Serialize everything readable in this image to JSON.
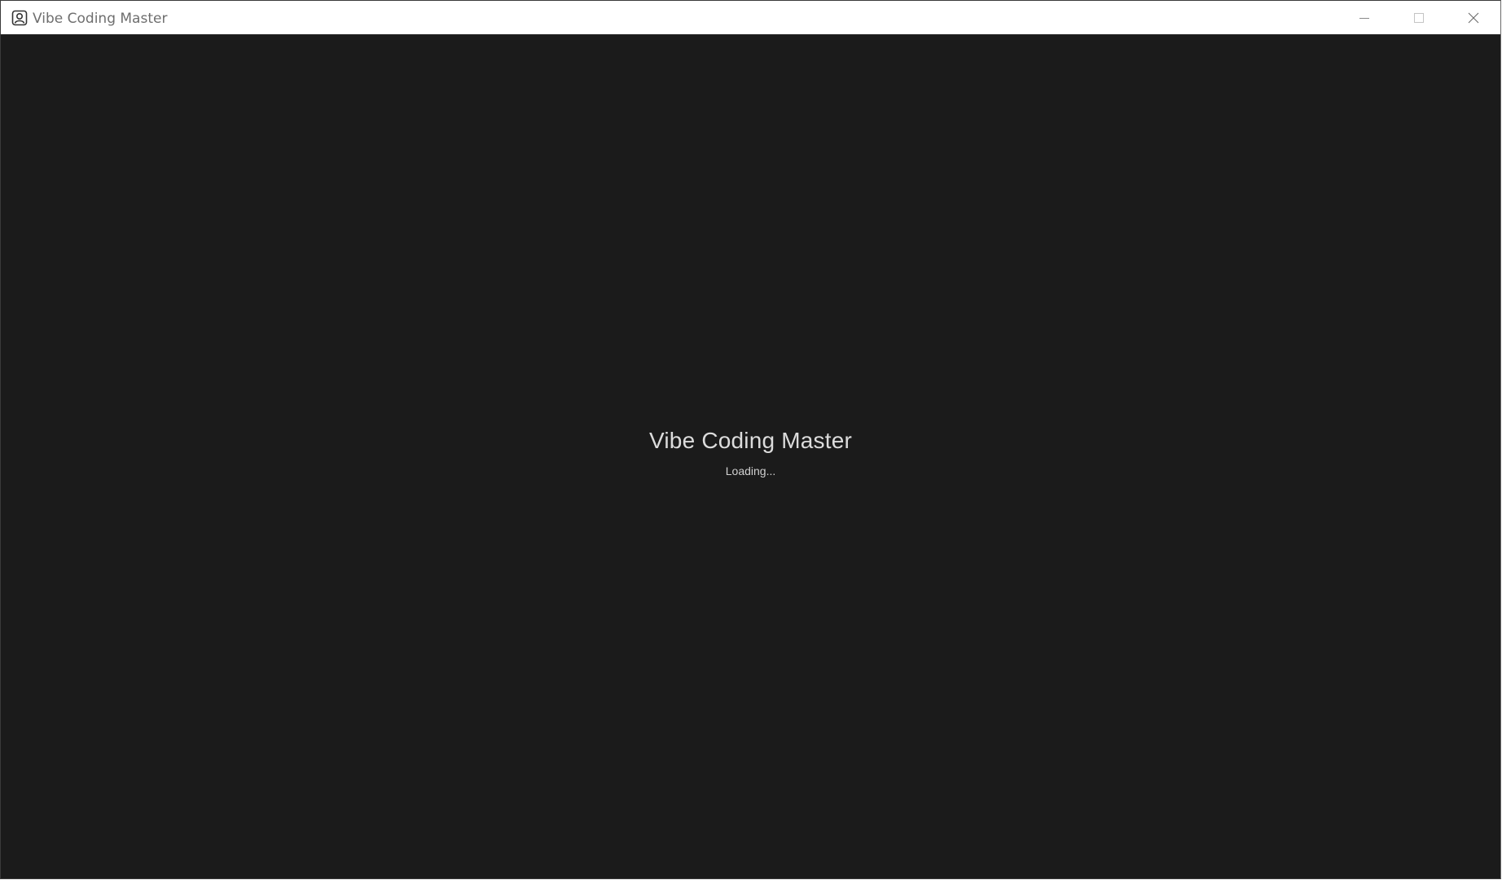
{
  "window": {
    "title": "Vibe Coding Master",
    "icon": "app-icon",
    "controls": {
      "minimize": "minimize-icon",
      "maximize": "maximize-icon",
      "close": "close-icon"
    }
  },
  "splash": {
    "title": "Vibe Coding Master",
    "status": "Loading..."
  },
  "colors": {
    "background": "#1b1b1b",
    "titlebar": "#ffffff",
    "title_text": "#6e6e6e",
    "splash_text": "#dcdcdc"
  }
}
